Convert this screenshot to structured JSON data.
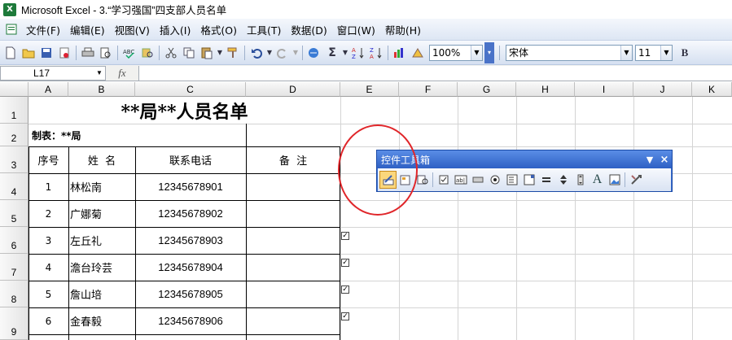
{
  "window": {
    "title": "Microsoft Excel - 3.“学习强国”四支部人员名单",
    "app_icon": "X"
  },
  "menu": [
    "文件(F)",
    "编辑(E)",
    "视图(V)",
    "插入(I)",
    "格式(O)",
    "工具(T)",
    "数据(D)",
    "窗口(W)",
    "帮助(H)"
  ],
  "toolbar": {
    "zoom": "100%",
    "font_name": "宋体",
    "font_size": "11",
    "bold_label": "B"
  },
  "formula_bar": {
    "name_box": "L17",
    "fx": "fx",
    "content": ""
  },
  "columns": [
    "A",
    "B",
    "C",
    "D",
    "E",
    "F",
    "G",
    "H",
    "I",
    "J",
    "K"
  ],
  "rows": [
    "1",
    "2",
    "3",
    "4",
    "5",
    "6",
    "7",
    "8",
    "9"
  ],
  "sheet": {
    "title": "**局**人员名单",
    "maker": "制表：**局",
    "headers": {
      "seq": "序号",
      "name": "姓  名",
      "phone": "联系电话",
      "note": "备  注"
    },
    "records": [
      {
        "seq": "1",
        "name": "林松南",
        "phone": "12345678901"
      },
      {
        "seq": "2",
        "name": "广娜菊",
        "phone": "12345678902"
      },
      {
        "seq": "3",
        "name": "左丘礼",
        "phone": "12345678903"
      },
      {
        "seq": "4",
        "name": "澹台玲芸",
        "phone": "12345678904"
      },
      {
        "seq": "5",
        "name": "詹山培",
        "phone": "12345678905"
      },
      {
        "seq": "6",
        "name": "金春毅",
        "phone": "12345678906"
      }
    ]
  },
  "controls_toolbar": {
    "title": "控件工具箱",
    "font_glyph": "A"
  },
  "colors": {
    "accent": "#3a6fd0",
    "highlight_circle": "#e0262a"
  }
}
